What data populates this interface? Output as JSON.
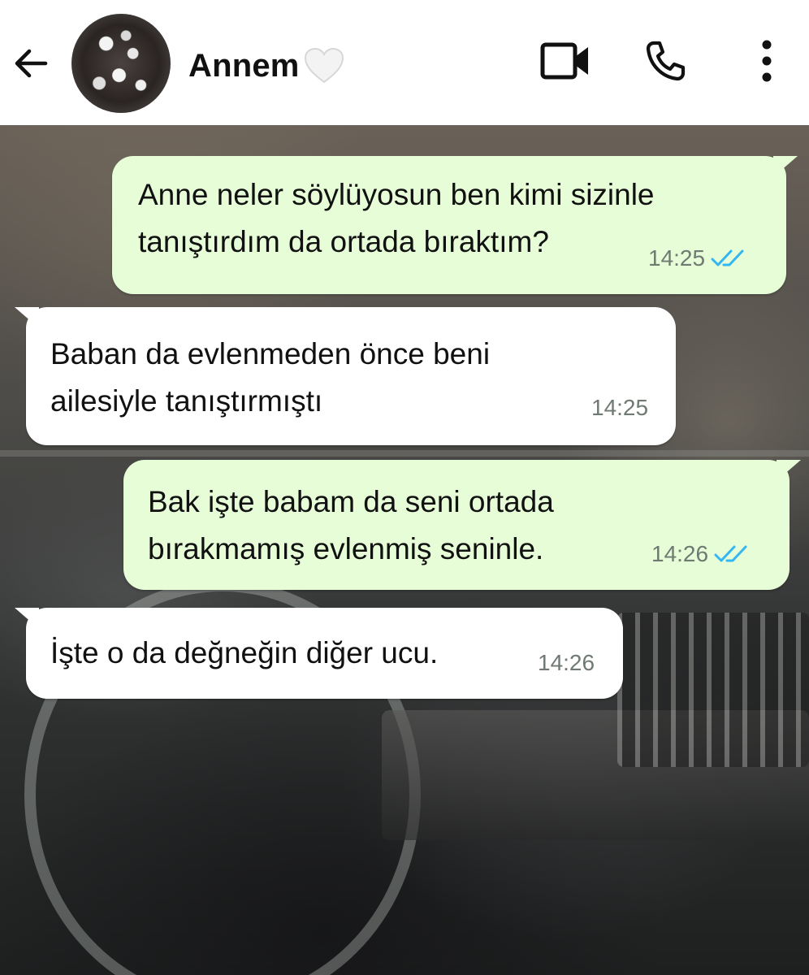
{
  "header": {
    "contact_name": "Annem",
    "back_icon": "arrow-left-icon",
    "heart_icon": "white-heart-icon",
    "video_call_icon": "video-camera-icon",
    "voice_call_icon": "phone-icon",
    "menu_icon": "more-vertical-icon"
  },
  "colors": {
    "outgoing_bubble": "#e6fdd7",
    "incoming_bubble": "#ffffff",
    "read_receipt": "#34b7f1",
    "timestamp": "#6f7a72"
  },
  "messages": [
    {
      "direction": "outgoing",
      "lines": [
        "Anne neler söylüyosun ben kimi sizinle",
        "tanıştırdım da ortada bıraktım?"
      ],
      "time": "14:25",
      "status": "read"
    },
    {
      "direction": "incoming",
      "lines": [
        "Baban da evlenmeden önce beni",
        "ailesiyle tanıştırmıştı"
      ],
      "time": "14:25"
    },
    {
      "direction": "outgoing",
      "lines": [
        "Bak işte babam da seni ortada",
        "bırakmamış evlenmiş seninle."
      ],
      "time": "14:26",
      "status": "read"
    },
    {
      "direction": "incoming",
      "lines": [
        "İşte o da değneğin diğer ucu."
      ],
      "time": "14:26"
    }
  ]
}
